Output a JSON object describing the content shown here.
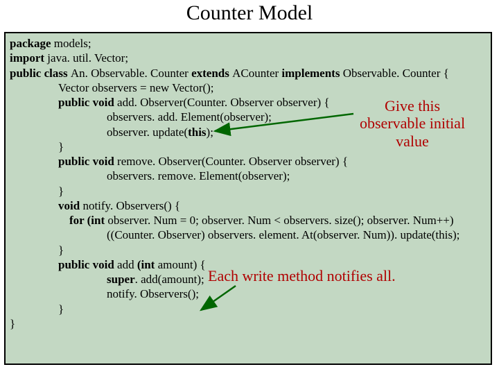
{
  "title": "Counter Model",
  "code": {
    "l1a": "package",
    "l1b": " models;",
    "l2a": "import",
    "l2b": " java. util. Vector;",
    "l3a": "public class ",
    "l3b": "An. Observable. Counter ",
    "l3c": "extends ",
    "l3d": "ACounter ",
    "l3e": "implements ",
    "l3f": "Observable. Counter {",
    "l4": "Vector observers = new Vector();",
    "l5a": "public void ",
    "l5b": "add. Observer(Counter. Observer observer) {",
    "l6": "observers. add. Element(observer);",
    "l7a": "observer. update(",
    "l7b": "this",
    "l7c": ");",
    "l8": "}",
    "l9a": "public void ",
    "l9b": "remove. Observer(Counter. Observer observer) {",
    "l10": "observers. remove. Element(observer);",
    "l11": "}",
    "l12a": "void ",
    "l12b": "notify. Observers() {",
    "l13a": "for (int ",
    "l13b": "observer. Num = 0; observer. Num < observers. size(); observer. Num++)",
    "l14": "((Counter. Observer) observers. element. At(observer. Num)). update(this);",
    "l15": "}",
    "l16a": "public void ",
    "l16b": "add ",
    "l16c": "(int ",
    "l16d": "amount) {",
    "l17a": "super",
    "l17b": ". add(amount);",
    "l18": "notify. Observers();",
    "l19": "}",
    "l20": "}"
  },
  "annot1_line1": "Give this",
  "annot1_line2": "observable initial",
  "annot1_line3": "value",
  "annot2": "Each write method notifies all."
}
